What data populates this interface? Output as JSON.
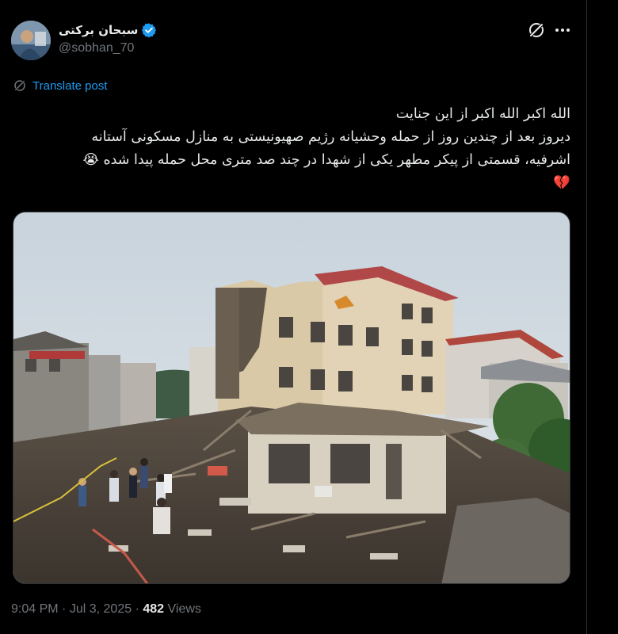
{
  "author": {
    "display_name": "سبحان برکتی",
    "handle": "@sobhan_70",
    "verified": true,
    "verified_color": "#1d9bf0"
  },
  "icons": {
    "grok": "grok-icon",
    "more": "more-icon",
    "translate": "translate-globe-icon",
    "verified": "verified-badge-icon"
  },
  "translate_label": "Translate post",
  "post": {
    "lines": [
      "الله اکبر الله اکبر از این جنایت",
      "دیروز بعد از چندین روز از حمله وحشیانه رژیم صهیونیستی به منازل مسکونی آستانه",
      "اشرفیه، قسمتی از پیکر مطهر یکی از شهدا در چند صد متری محل حمله پیدا شده 😭",
      "💔"
    ]
  },
  "footer": {
    "time": "9:04 PM",
    "separator": "·",
    "date": "Jul 3, 2025",
    "views_count": "482",
    "views_label": "Views"
  },
  "colors": {
    "background": "#000000",
    "text": "#e7e9ea",
    "muted": "#71767b",
    "accent": "#1d9bf0",
    "border": "#2f3336"
  }
}
